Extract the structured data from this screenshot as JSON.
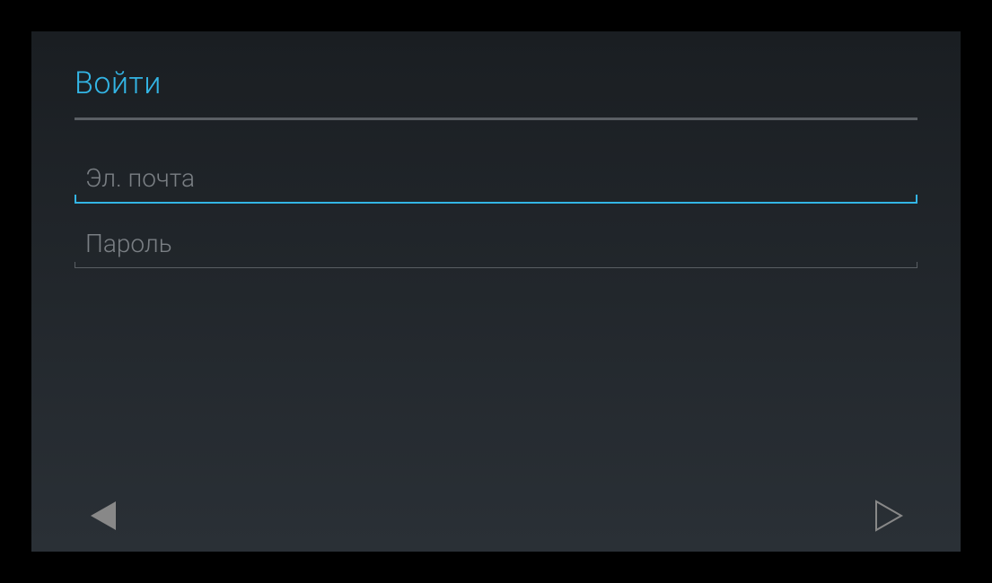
{
  "header": {
    "title": "Войти"
  },
  "form": {
    "email": {
      "placeholder": "Эл. почта",
      "value": ""
    },
    "password": {
      "placeholder": "Пароль",
      "value": ""
    }
  },
  "colors": {
    "accent": "#33b5e5",
    "background_dark": "#1a1e22",
    "background_light": "#2a3036",
    "divider": "#5a5f64",
    "placeholder": "#7a7f84"
  }
}
